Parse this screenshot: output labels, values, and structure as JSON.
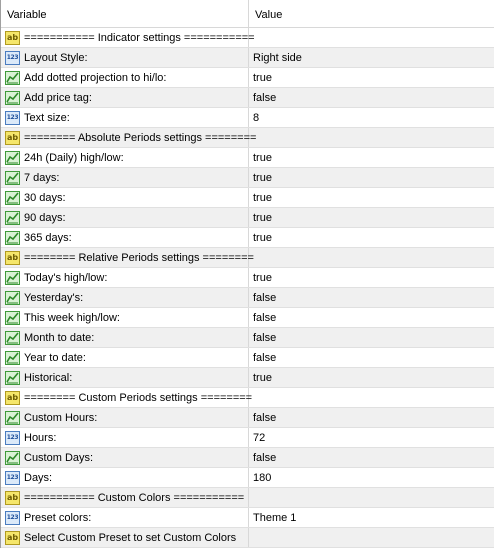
{
  "header": {
    "variable": "Variable",
    "value": "Value"
  },
  "rows": [
    {
      "type": "ab",
      "name": "=========== Indicator settings ===========",
      "value": ""
    },
    {
      "type": "num",
      "name": "Layout Style:",
      "value": "Right side"
    },
    {
      "type": "bool",
      "name": "Add dotted projection to hi/lo:",
      "value": "true"
    },
    {
      "type": "bool",
      "name": "Add price tag:",
      "value": "false"
    },
    {
      "type": "num",
      "name": "Text size:",
      "value": "8"
    },
    {
      "type": "ab",
      "name": "======== Absolute Periods settings ========",
      "value": ""
    },
    {
      "type": "bool",
      "name": "24h (Daily) high/low:",
      "value": "true"
    },
    {
      "type": "bool",
      "name": "7 days:",
      "value": "true"
    },
    {
      "type": "bool",
      "name": "30 days:",
      "value": "true"
    },
    {
      "type": "bool",
      "name": "90 days:",
      "value": "true"
    },
    {
      "type": "bool",
      "name": "365 days:",
      "value": "true"
    },
    {
      "type": "ab",
      "name": "======== Relative Periods settings ========",
      "value": ""
    },
    {
      "type": "bool",
      "name": "Today's high/low:",
      "value": "true"
    },
    {
      "type": "bool",
      "name": "Yesterday's:",
      "value": "false"
    },
    {
      "type": "bool",
      "name": "This week high/low:",
      "value": "false"
    },
    {
      "type": "bool",
      "name": "Month to date:",
      "value": "false"
    },
    {
      "type": "bool",
      "name": "Year to date:",
      "value": "false"
    },
    {
      "type": "bool",
      "name": "Historical:",
      "value": "true"
    },
    {
      "type": "ab",
      "name": "======== Custom Periods settings ========",
      "value": ""
    },
    {
      "type": "bool",
      "name": "Custom Hours:",
      "value": "false"
    },
    {
      "type": "num",
      "name": "Hours:",
      "value": "72"
    },
    {
      "type": "bool",
      "name": "Custom Days:",
      "value": "false"
    },
    {
      "type": "num",
      "name": "Days:",
      "value": "180"
    },
    {
      "type": "ab",
      "name": "=========== Custom Colors ===========",
      "value": ""
    },
    {
      "type": "num",
      "name": "Preset colors:",
      "value": "Theme 1"
    },
    {
      "type": "ab",
      "name": "Select Custom Preset to set Custom Colors",
      "value": ""
    }
  ],
  "icons": {
    "ab": {
      "name": "string-icon",
      "glyph": "ab"
    },
    "num": {
      "name": "integer-icon",
      "glyph": "123"
    },
    "bool": {
      "name": "boolean-icon",
      "glyph": ""
    }
  }
}
